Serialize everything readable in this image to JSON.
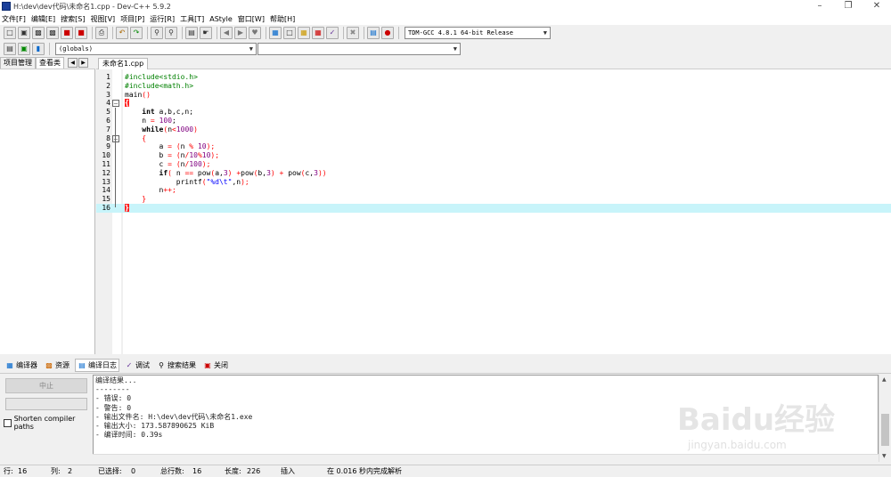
{
  "window": {
    "title": "H:\\dev\\dev代码\\未命名1.cpp - Dev-C++ 5.9.2"
  },
  "menu": [
    "文件[F]",
    "编辑[E]",
    "搜索[S]",
    "视图[V]",
    "项目[P]",
    "运行[R]",
    "工具[T]",
    "AStyle",
    "窗口[W]",
    "帮助[H]"
  ],
  "toolbar": {
    "compiler_select": "TDM-GCC 4.8.1 64-bit Release",
    "scope_select": "(globals)",
    "member_select": ""
  },
  "left_tabs": {
    "project": "项目管理",
    "class_view": "查看类"
  },
  "editor": {
    "tab": "未命名1.cpp",
    "current_line": 16
  },
  "bottom_tabs": {
    "compiler": "编译器",
    "resources": "资源",
    "compile_log": "编译日志",
    "debug": "调试",
    "search_results": "搜索结果",
    "close": "关闭"
  },
  "compile_panel": {
    "abort_label": "中止",
    "shorten_paths_label": "Shorten compiler paths",
    "log_lines": [
      "编译结果...",
      "--------",
      "- 错误: 0",
      "- 警告: 0",
      "- 输出文件名: H:\\dev\\dev代码\\未命名1.exe",
      "- 输出大小: 173.587890625 KiB",
      "- 编译时间: 0.39s"
    ]
  },
  "status": {
    "row_label": "行:",
    "row": "16",
    "col_label": "列:",
    "col": "2",
    "selected_label": "已选择:",
    "selected": "0",
    "lines_label": "总行数:",
    "lines": "16",
    "length_label": "长度:",
    "length": "226",
    "mode": "插入",
    "parse_msg": "在 0.016 秒内完成解析"
  },
  "watermark": {
    "brand": "Baidu经验",
    "url": "jingyan.baidu.com"
  }
}
